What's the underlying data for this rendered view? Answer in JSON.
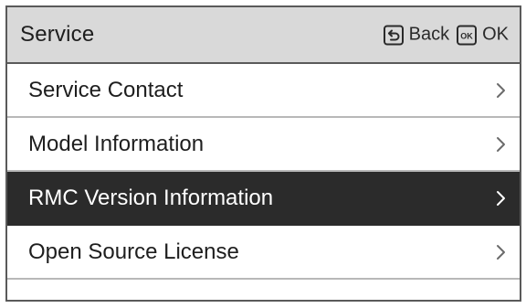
{
  "header": {
    "title": "Service",
    "back_label": "Back",
    "ok_label": "OK",
    "back_icon": "return-arrow-icon",
    "ok_icon": "ok-key-icon"
  },
  "menu": {
    "items": [
      {
        "label": "Service Contact",
        "selected": false
      },
      {
        "label": "Model Information",
        "selected": false
      },
      {
        "label": "RMC Version Information",
        "selected": true
      },
      {
        "label": "Open Source License",
        "selected": false
      }
    ]
  },
  "colors": {
    "header_bg": "#d9d9d9",
    "selected_bg": "#2b2b2b",
    "border": "#5a5a5a",
    "divider": "#b8b8b8"
  }
}
